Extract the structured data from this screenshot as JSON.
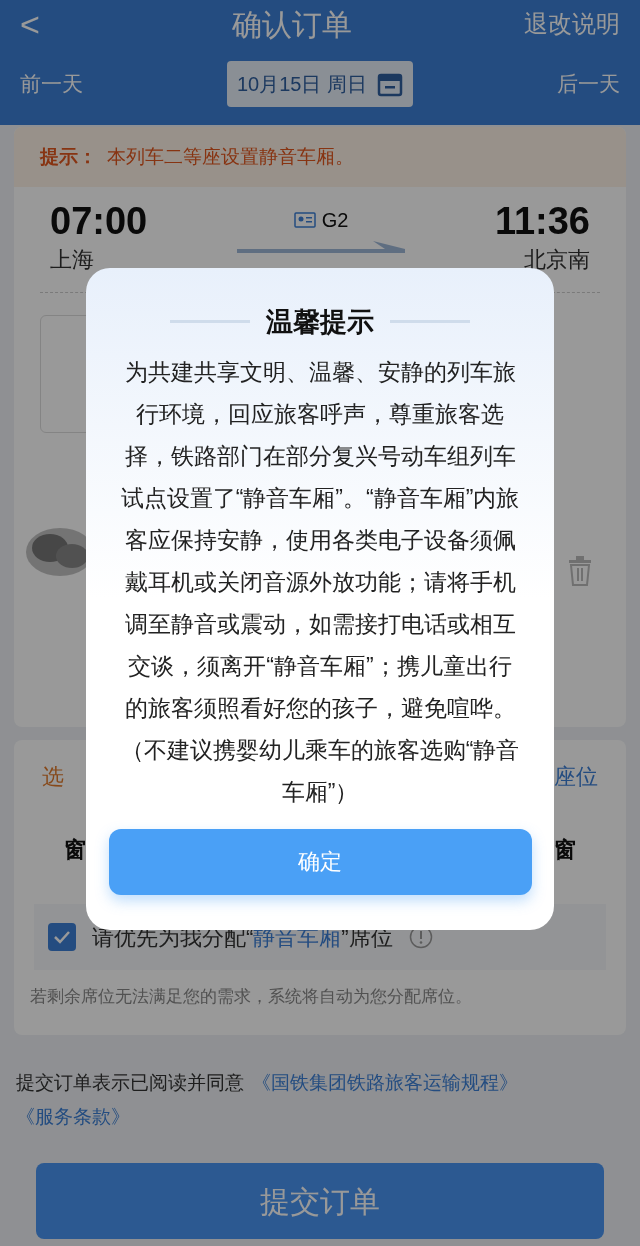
{
  "header": {
    "back": "<",
    "title": "确认订单",
    "action": "退改说明"
  },
  "date_bar": {
    "prev": "前一天",
    "date": "10月15日 周日",
    "next": "后一天"
  },
  "tip": {
    "label": "提示：",
    "text": "本列车二等座设置静音车厢。"
  },
  "trip": {
    "depart_time": "07:00",
    "depart_station": "上海",
    "train": "G2",
    "arrive_time": "11:36",
    "arrive_station": "北京南"
  },
  "seat_section": {
    "title": "选",
    "link": "座位",
    "seat_left": "窗",
    "seat_right": "窗"
  },
  "quiet_option": {
    "checked": true,
    "segments": [
      {
        "text": "请优先为我分配“",
        "highlight": false
      },
      {
        "text": "静音车厢",
        "highlight": true
      },
      {
        "text": "”席位",
        "highlight": false
      }
    ]
  },
  "quiet_note": "若剩余席位无法满足您的需求，系统将自动为您分配席位。",
  "agreement": {
    "text": "提交订单表示已阅读并同意",
    "links": [
      "《国铁集团铁路旅客运输规程》",
      "《服务条款》"
    ]
  },
  "submit": "提交订单",
  "dialog": {
    "title": "温馨提示",
    "body": "为共建共享文明、温馨、安静的列车旅行环境，回应旅客呼声，尊重旅客选择，铁路部门在部分复兴号动车组列车试点设置了“静音车厢”。“静音车厢”内旅客应保持安静，使用各类电子设备须佩戴耳机或关闭音源外放功能；请将手机调至静音或震动，如需接打电话或相互交谈，须离开“静音车厢”；携儿童出行的旅客须照看好您的孩子，避免喧哗。（不建议携婴幼儿乘车的旅客选购“静音车厢”）",
    "button": "确定"
  }
}
